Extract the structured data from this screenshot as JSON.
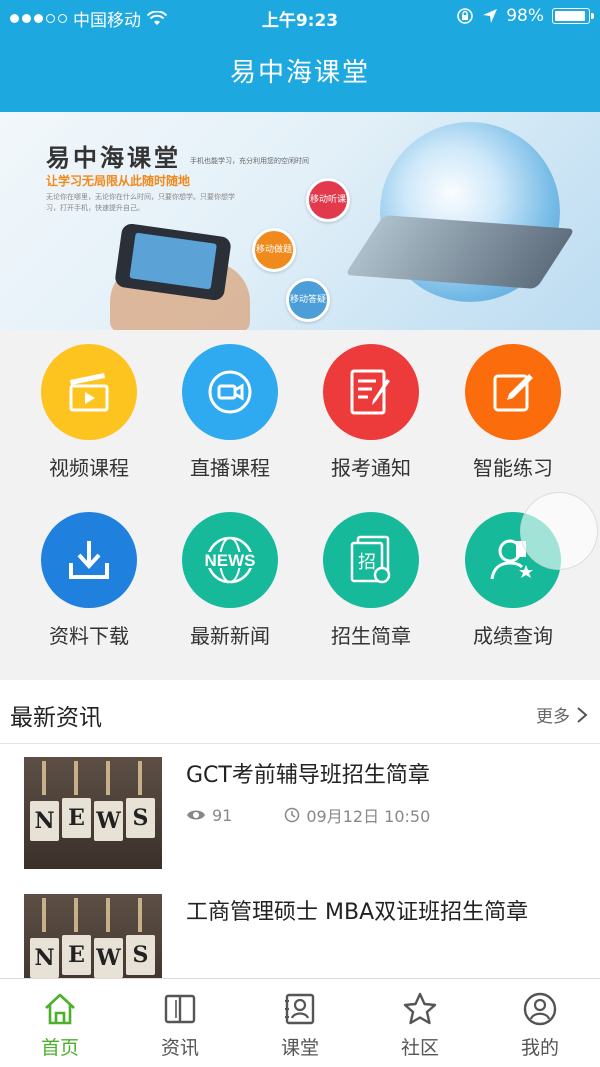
{
  "status_bar": {
    "carrier": "中国移动",
    "time": "上午9:23",
    "battery": "98%"
  },
  "header": {
    "title": "易中海课堂"
  },
  "banner": {
    "title": "易中海课堂",
    "slogan": "让学习无局限从此随时随地",
    "tagline": "手机也能学习，充分利用您的空闲时间",
    "desc": "无论你在哪里，无论你在什么时间，只要你想学。只要你想学习，打开手机，快速提升自己。",
    "bubbles": [
      "移动听课",
      "移动做题",
      "移动答疑"
    ]
  },
  "menu": [
    {
      "label": "视频课程",
      "icon": "clapperboard-icon",
      "color": "#fdc31f"
    },
    {
      "label": "直播课程",
      "icon": "video-camera-icon",
      "color": "#2fa9ef"
    },
    {
      "label": "报考通知",
      "icon": "notice-pen-icon",
      "color": "#ec3b3a"
    },
    {
      "label": "智能练习",
      "icon": "edit-icon",
      "color": "#fb6d0c"
    },
    {
      "label": "资料下载",
      "icon": "download-icon",
      "color": "#1f80dd"
    },
    {
      "label": "最新新闻",
      "icon": "news-globe-icon",
      "color": "#16b999"
    },
    {
      "label": "招生简章",
      "icon": "admission-doc-icon",
      "color": "#16b999"
    },
    {
      "label": "成绩查询",
      "icon": "user-star-icon",
      "color": "#16b999"
    }
  ],
  "news": {
    "title": "最新资讯",
    "more": "更多",
    "items": [
      {
        "title": "GCT考前辅导班招生简章",
        "views": "91",
        "date": "09月12日 10:50"
      },
      {
        "title": "工商管理硕士 MBA双证班招生简章",
        "views": "",
        "date": ""
      }
    ],
    "thumb_letters": [
      "N",
      "E",
      "W",
      "S"
    ]
  },
  "tabs": [
    {
      "label": "首页",
      "icon": "home-icon",
      "active": true
    },
    {
      "label": "资讯",
      "icon": "book-icon",
      "active": false
    },
    {
      "label": "课堂",
      "icon": "classroom-icon",
      "active": false
    },
    {
      "label": "社区",
      "icon": "star-icon",
      "active": false
    },
    {
      "label": "我的",
      "icon": "user-icon",
      "active": false
    }
  ],
  "colors": {
    "primary": "#1ea8e0",
    "tab_active": "#4bb02a"
  }
}
